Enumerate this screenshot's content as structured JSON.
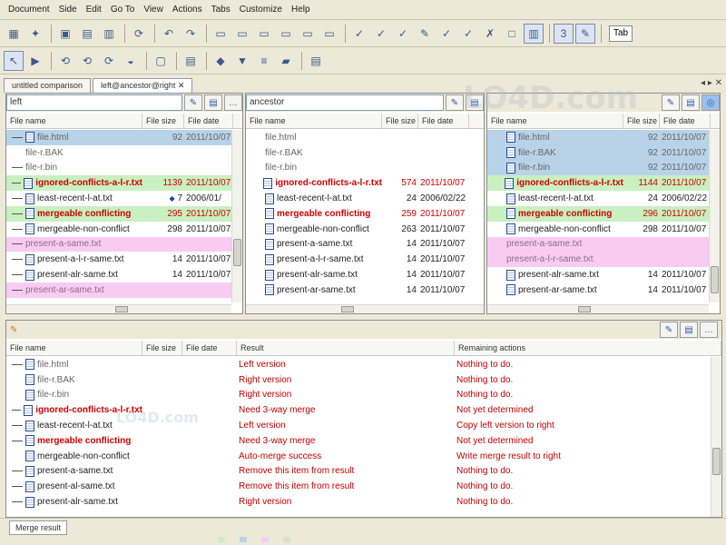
{
  "menubar": [
    "Document",
    "Side",
    "Edit",
    "Go To",
    "View",
    "Actions",
    "Tabs",
    "Customize",
    "Help"
  ],
  "toolbar": {
    "mini_field": "Tab"
  },
  "tabs": [
    {
      "label": "untitled comparison"
    },
    {
      "label": "left@ancestor@right",
      "active": true
    }
  ],
  "left_pane": {
    "path": "left",
    "columns": [
      "File name",
      "File size",
      "File date"
    ],
    "rows": [
      {
        "name": "file.html",
        "size": "92",
        "date": "2011/10/07",
        "bg": "blue",
        "fg": "grey",
        "tree": "line"
      },
      {
        "name": "file-r.BAK",
        "size": "",
        "date": "",
        "bg": "none",
        "fg": "grey",
        "tree": "blank-noicon"
      },
      {
        "name": "file-r.bin",
        "size": "",
        "date": "",
        "bg": "none",
        "fg": "grey",
        "tree": "line-noicon"
      },
      {
        "name": "ignored-conflicts-a-l-r.txt",
        "size": "1139",
        "date": "2011/10/07",
        "bg": "green",
        "fg": "red",
        "tree": "line"
      },
      {
        "name": "least-recent-l-at.txt",
        "size": "7",
        "date": "2006/01/",
        "bg": "none",
        "fg": "normal",
        "tree": "line",
        "flag": "◆"
      },
      {
        "name": "mergeable conflicting",
        "size": "295",
        "date": "2011/10/07",
        "bg": "green",
        "fg": "red",
        "tree": "line"
      },
      {
        "name": "mergeable-non-conflict",
        "size": "298",
        "date": "2011/10/07",
        "bg": "none",
        "fg": "normal",
        "tree": "line"
      },
      {
        "name": "present-a-same.txt",
        "size": "",
        "date": "",
        "bg": "pink",
        "fg": "pinkgrey",
        "tree": "line-noicon"
      },
      {
        "name": "present-a-l-r-same.txt",
        "size": "14",
        "date": "2011/10/07",
        "bg": "none",
        "fg": "normal",
        "tree": "line"
      },
      {
        "name": "present-alr-same.txt",
        "size": "14",
        "date": "2011/10/07",
        "bg": "none",
        "fg": "normal",
        "tree": "line"
      },
      {
        "name": "present-ar-same.txt",
        "size": "",
        "date": "",
        "bg": "pink",
        "fg": "pinkgrey",
        "tree": "line-noicon"
      }
    ]
  },
  "ancestor_pane": {
    "path": "ancestor",
    "columns": [
      "File name",
      "File size",
      "File date"
    ],
    "rows": [
      {
        "name": "file.html",
        "size": "",
        "date": "",
        "bg": "none",
        "fg": "grey",
        "tree": "blank-noicon"
      },
      {
        "name": "file-r.BAK",
        "size": "",
        "date": "",
        "bg": "none",
        "fg": "grey",
        "tree": "blank-noicon"
      },
      {
        "name": "file-r.bin",
        "size": "",
        "date": "",
        "bg": "none",
        "fg": "grey",
        "tree": "blank-noicon"
      },
      {
        "name": "ignored-conflicts-a-l-r.txt",
        "size": "574",
        "date": "2011/10/07",
        "bg": "none",
        "fg": "red",
        "tree": "blank"
      },
      {
        "name": "least-recent-l-at.txt",
        "size": "24",
        "date": "2006/02/22",
        "bg": "none",
        "fg": "normal",
        "tree": "blank"
      },
      {
        "name": "mergeable conflicting",
        "size": "259",
        "date": "2011/10/07",
        "bg": "none",
        "fg": "red",
        "tree": "blank"
      },
      {
        "name": "mergeable-non-conflict",
        "size": "263",
        "date": "2011/10/07",
        "bg": "none",
        "fg": "normal",
        "tree": "blank"
      },
      {
        "name": "present-a-same.txt",
        "size": "14",
        "date": "2011/10/07",
        "bg": "none",
        "fg": "normal",
        "tree": "blank"
      },
      {
        "name": "present-a-l-r-same.txt",
        "size": "14",
        "date": "2011/10/07",
        "bg": "none",
        "fg": "normal",
        "tree": "blank"
      },
      {
        "name": "present-alr-same.txt",
        "size": "14",
        "date": "2011/10/07",
        "bg": "none",
        "fg": "normal",
        "tree": "blank"
      },
      {
        "name": "present-ar-same.txt",
        "size": "14",
        "date": "2011/10/07",
        "bg": "none",
        "fg": "normal",
        "tree": "blank"
      }
    ]
  },
  "right_pane": {
    "path": "",
    "columns": [
      "File name",
      "File size",
      "File date"
    ],
    "rows": [
      {
        "name": "file.html",
        "size": "92",
        "date": "2011/10/07",
        "bg": "blue",
        "fg": "grey",
        "tree": "blank"
      },
      {
        "name": "file-r.BAK",
        "size": "92",
        "date": "2011/10/07",
        "bg": "blue",
        "fg": "grey",
        "tree": "blank"
      },
      {
        "name": "file-r.bin",
        "size": "92",
        "date": "2011/10/07",
        "bg": "blue",
        "fg": "grey",
        "tree": "blank"
      },
      {
        "name": "ignored-conflicts-a-l-r.txt",
        "size": "1144",
        "date": "2011/10/07",
        "bg": "green",
        "fg": "red",
        "tree": "blank"
      },
      {
        "name": "least-recent-l-at.txt",
        "size": "24",
        "date": "2006/02/22",
        "bg": "none",
        "fg": "normal",
        "tree": "blank"
      },
      {
        "name": "mergeable conflicting",
        "size": "296",
        "date": "2011/10/07",
        "bg": "green",
        "fg": "red",
        "tree": "blank"
      },
      {
        "name": "mergeable-non-conflict",
        "size": "298",
        "date": "2011/10/07",
        "bg": "none",
        "fg": "normal",
        "tree": "blank"
      },
      {
        "name": "present-a-same.txt",
        "size": "",
        "date": "",
        "bg": "pink",
        "fg": "pinkgrey",
        "tree": "blank-noicon"
      },
      {
        "name": "present-a-l-r-same.txt",
        "size": "",
        "date": "",
        "bg": "pink",
        "fg": "pinkgrey",
        "tree": "blank-noicon"
      },
      {
        "name": "present-alr-same.txt",
        "size": "14",
        "date": "2011/10/07",
        "bg": "none",
        "fg": "normal",
        "tree": "blank"
      },
      {
        "name": "present-ar-same.txt",
        "size": "14",
        "date": "2011/10/07",
        "bg": "none",
        "fg": "normal",
        "tree": "blank"
      }
    ]
  },
  "merge_pane": {
    "path": "",
    "columns": [
      "File name",
      "File size",
      "File date",
      "Result",
      "Remaining actions"
    ],
    "rows": [
      {
        "name": "file.html",
        "result": "Left version",
        "action": "Nothing to do.",
        "tree": "line",
        "fg": "grey"
      },
      {
        "name": "file-r.BAK",
        "result": "Right version",
        "action": "Nothing to do.",
        "tree": "blank",
        "fg": "grey"
      },
      {
        "name": "file-r.bin",
        "result": "Right version",
        "action": "Nothing to do.",
        "tree": "blank",
        "fg": "grey"
      },
      {
        "name": "ignored-conflicts-a-l-r.txt",
        "result": "Need 3-way merge",
        "action": "Not yet determined",
        "tree": "line",
        "fg": "red"
      },
      {
        "name": "least-recent-l-at.txt",
        "result": "Left version",
        "action": "Copy left version to right",
        "tree": "line",
        "fg": "normal"
      },
      {
        "name": "mergeable conflicting",
        "result": "Need 3-way merge",
        "action": "Not yet determined",
        "tree": "line",
        "fg": "red"
      },
      {
        "name": "mergeable-non-conflict",
        "result": "Auto-merge success",
        "action": "Write merge result to right",
        "tree": "blank",
        "fg": "normal"
      },
      {
        "name": "present-a-same.txt",
        "result": "Remove this item from result",
        "action": "Nothing to do.",
        "tree": "line",
        "fg": "normal"
      },
      {
        "name": "present-al-same.txt",
        "result": "Remove this item from result",
        "action": "Nothing to do.",
        "tree": "line",
        "fg": "normal"
      },
      {
        "name": "present-alr-same.txt",
        "result": "Right version",
        "action": "Nothing to do.",
        "tree": "line",
        "fg": "normal"
      }
    ]
  },
  "status": {
    "merge_tab": "Merge result"
  },
  "watermark": {
    "brand": "LO4D.com"
  },
  "colors": {
    "blue": "#b8d3e8",
    "green": "#c8f0c0",
    "pink": "#f8ccf2",
    "conflict": "#d00000"
  }
}
